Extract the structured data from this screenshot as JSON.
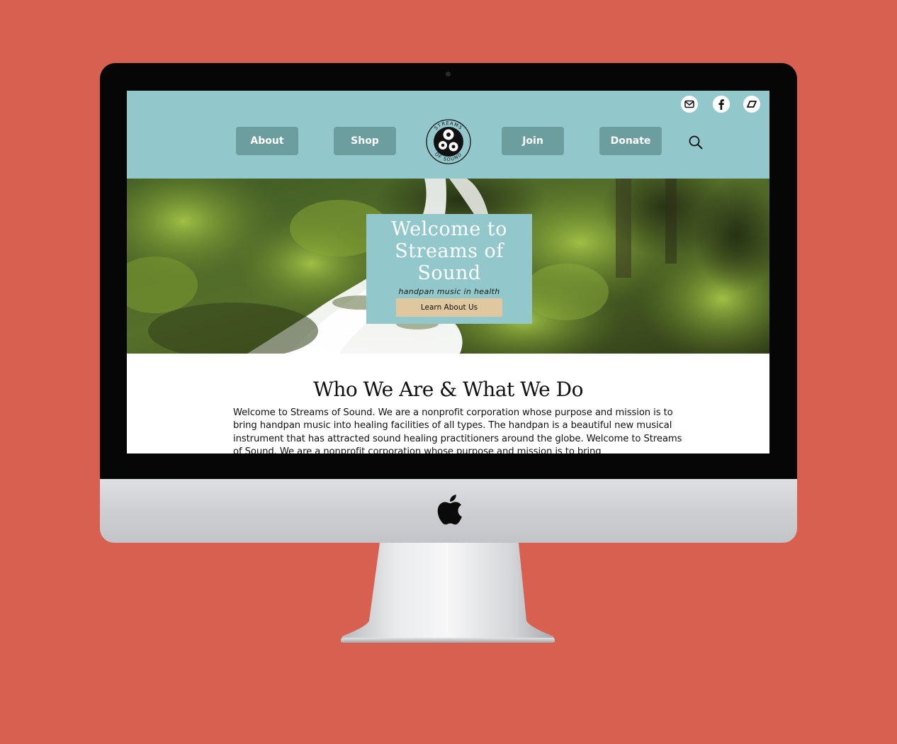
{
  "colors": {
    "background": "#d86050",
    "header": "#92c8cb",
    "nav_button": "#6c9d9f",
    "cta_button": "#dfc7a0"
  },
  "social": [
    "email-icon",
    "facebook-icon",
    "bandcamp-icon"
  ],
  "nav": {
    "about": "About",
    "shop": "Shop",
    "join": "Join",
    "donate": "Donate"
  },
  "logo": {
    "ring_top": "STREAMS",
    "ring_bottom": "OF SOUND"
  },
  "hero": {
    "title": "Welcome to\nStreams of\nSound",
    "tagline": "handpan music in health",
    "cta": "Learn About Us"
  },
  "about": {
    "title": "Who We Are & What We Do",
    "body": "Welcome to Streams of Sound. We are a nonprofit corporation whose purpose and mission is to bring handpan music into healing facilities of all types. The handpan is a beautiful new musical instrument that has attracted sound healing practitioners around the globe. Welcome to Streams of Sound. We are a nonprofit corporation whose purpose and mission is to bring"
  }
}
